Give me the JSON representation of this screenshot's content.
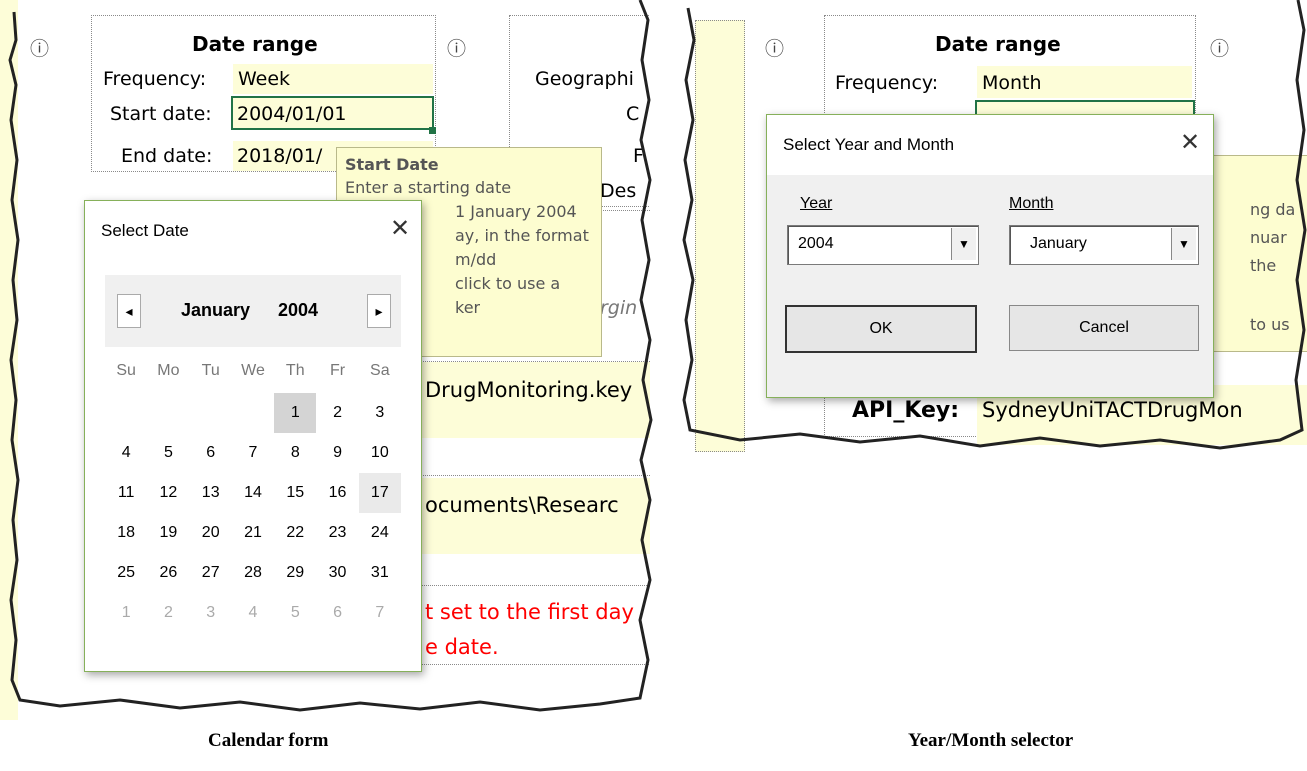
{
  "left": {
    "info_icon": "ⓘ",
    "date_range": {
      "title": "Date range",
      "frequency_label": "Frequency:",
      "frequency_value": "Week",
      "start_label": "Start date:",
      "start_value": "2004/01/01",
      "end_label": "End date:",
      "end_value": "2018/01/"
    },
    "geo_label": "Geographi",
    "right_labels": [
      "C",
      "F",
      "Des"
    ],
    "italic_text": "rgin",
    "tooltip": {
      "title": "Start Date",
      "lines": [
        "Enter a starting date",
        "1 January 2004",
        "ay, in the format",
        "m/dd",
        "click to use a",
        "ker"
      ]
    },
    "key_text": "DrugMonitoring.key",
    "path_text": "ocuments\\Researc",
    "red_lines": [
      "t set to the first day",
      "e date."
    ],
    "calendar": {
      "title": "Select Date",
      "close_icon": "✕",
      "prev_icon": "◂",
      "next_icon": "▸",
      "month": "January",
      "year": "2004",
      "weekdays": [
        "Su",
        "Mo",
        "Tu",
        "We",
        "Th",
        "Fr",
        "Sa"
      ],
      "weeks": [
        [
          "",
          "",
          "",
          "",
          "1",
          "2",
          "3"
        ],
        [
          "4",
          "5",
          "6",
          "7",
          "8",
          "9",
          "10"
        ],
        [
          "11",
          "12",
          "13",
          "14",
          "15",
          "16",
          "17"
        ],
        [
          "18",
          "19",
          "20",
          "21",
          "22",
          "23",
          "24"
        ],
        [
          "25",
          "26",
          "27",
          "28",
          "29",
          "30",
          "31"
        ],
        [
          "1",
          "2",
          "3",
          "4",
          "5",
          "6",
          "7"
        ]
      ],
      "selected_day": "1",
      "hover_day": "17"
    }
  },
  "right": {
    "info_icon": "ⓘ",
    "date_range_title": "Date range",
    "frequency_label": "Frequency:",
    "frequency_value": "Month",
    "tooltip_fragments": [
      "ng da",
      "nuar",
      "the",
      "to us"
    ],
    "api_label": "API_Key:",
    "api_value": "SydneyUniTACTDrugMon",
    "dialog": {
      "title": "Select Year and Month",
      "close_icon": "✕",
      "year_label": "Year",
      "year_value": "2004",
      "month_label": "Month",
      "month_value": "January",
      "ok_label": "OK",
      "cancel_label": "Cancel",
      "drop_icon": "▼"
    }
  },
  "captions": {
    "left": "Calendar form",
    "right": "Year/Month selector"
  },
  "colors": {
    "dialog_border": "#86b05a",
    "field_yellow": "#fdfdd8",
    "selected_cell_border": "#217346",
    "red_text": "#ff0000"
  }
}
